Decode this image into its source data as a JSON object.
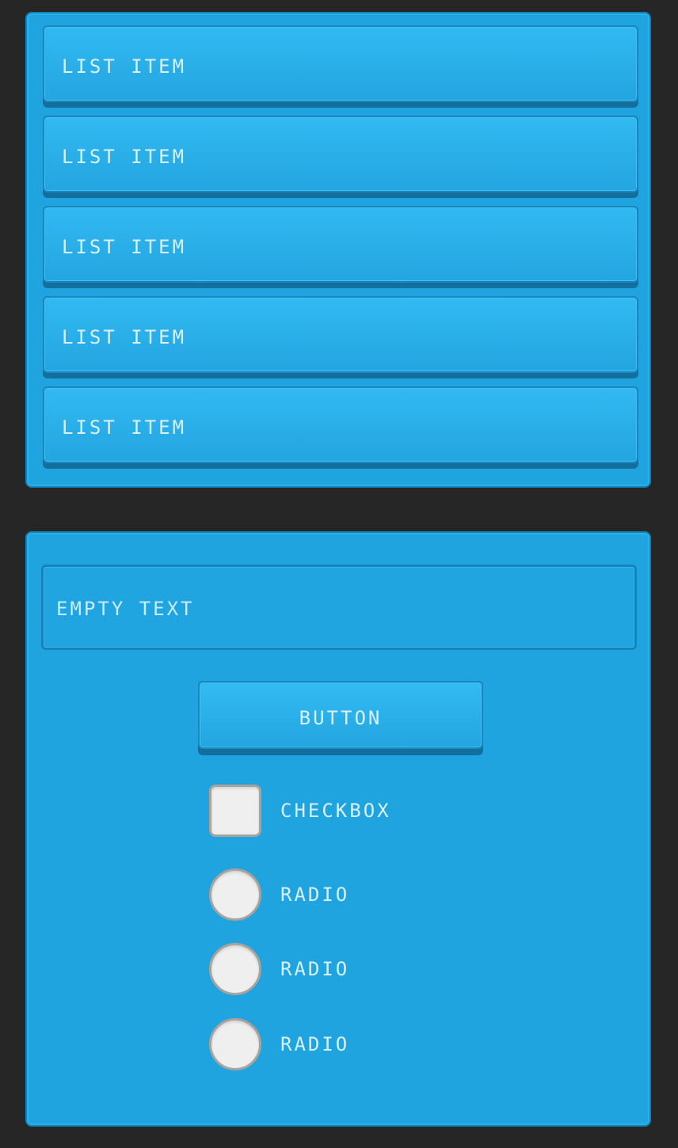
{
  "list": {
    "items": [
      {
        "label": "LIST ITEM"
      },
      {
        "label": "LIST ITEM"
      },
      {
        "label": "LIST ITEM"
      },
      {
        "label": "LIST ITEM"
      },
      {
        "label": "LIST ITEM"
      }
    ]
  },
  "form": {
    "text_field": {
      "value": "",
      "placeholder": "EMPTY TEXT"
    },
    "button_label": "BUTTON",
    "checkbox": {
      "label": "CHECKBOX",
      "checked": false
    },
    "radios": [
      {
        "label": "RADIO",
        "selected": false
      },
      {
        "label": "RADIO",
        "selected": false
      },
      {
        "label": "RADIO",
        "selected": false
      }
    ]
  },
  "colors": {
    "background": "#262626",
    "panel": "#1fa4df",
    "item_face": "#2fb4ee",
    "item_shadow": "#136f9e",
    "text": "#d8f1fd",
    "control_fill": "#efefef",
    "control_border": "#a9a29d"
  }
}
